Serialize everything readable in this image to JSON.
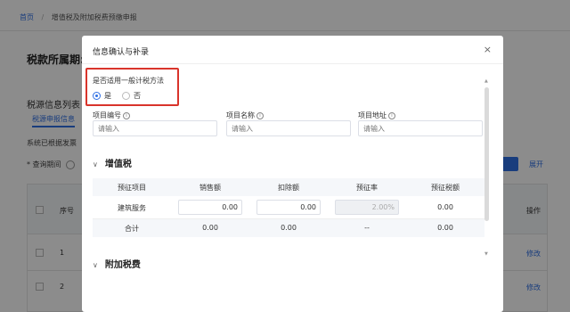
{
  "background": {
    "breadcrumb": {
      "home": "首页",
      "separator": "/",
      "current": "增值税及附加税费预缴申报"
    },
    "period_label": "税款所属期:",
    "list_title": "税源信息列表",
    "tab_label": "税源申报信息",
    "system_text": "系统已根据发票",
    "query_label": "* 查询期间",
    "expand_label": "展开",
    "table": {
      "col_seq": "序号",
      "col_op": "操作",
      "rows": [
        {
          "seq": "1",
          "op": "修改"
        },
        {
          "seq": "2",
          "op": "修改"
        }
      ]
    }
  },
  "modal": {
    "title": "信息确认与补录",
    "close_glyph": "×",
    "question": "是否适用一般计税方法",
    "options": [
      {
        "label": "是",
        "checked": true
      },
      {
        "label": "否",
        "checked": false
      }
    ],
    "fields": [
      {
        "label": "项目编号",
        "placeholder": "请输入"
      },
      {
        "label": "项目名称",
        "placeholder": "请输入"
      },
      {
        "label": "项目地址",
        "placeholder": "请输入"
      }
    ],
    "info_glyph": "i",
    "vat_section": {
      "chevron": "∨",
      "title": "增值税"
    },
    "vat_table": {
      "headers": [
        "预征项目",
        "销售额",
        "扣除额",
        "预征率",
        "预征税额"
      ],
      "row": {
        "item": "建筑服务",
        "sales": "0.00",
        "deduction": "0.00",
        "rate": "2.00%",
        "tax": "0.00"
      },
      "total": {
        "label": "合计",
        "sales": "0.00",
        "deduction": "0.00",
        "rate": "--",
        "tax": "0.00"
      }
    },
    "surcharge_section": {
      "chevron": "∨",
      "title": "附加税费"
    }
  },
  "colors": {
    "accent": "#2f6fe4",
    "highlight": "#d9342b"
  }
}
